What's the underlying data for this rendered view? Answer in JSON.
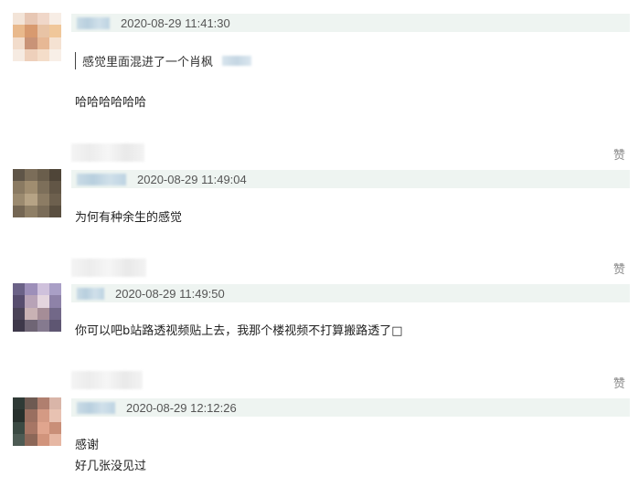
{
  "like_label": "赞",
  "comments": [
    {
      "time": "2020-08-29 11:41:30",
      "quote": "感觉里面混进了一个肖枫",
      "lines": [
        "哈哈哈哈哈哈"
      ]
    },
    {
      "time": "2020-08-29 11:49:04",
      "lines": [
        "为何有种余生的感觉"
      ]
    },
    {
      "time": "2020-08-29 11:49:50",
      "lines": [
        "你可以吧b站路透视频贴上去，我那个楼视频不打算搬路透了□"
      ]
    },
    {
      "time": "2020-08-29 12:12:26",
      "lines": [
        "感谢",
        "好几张没见过"
      ]
    }
  ]
}
